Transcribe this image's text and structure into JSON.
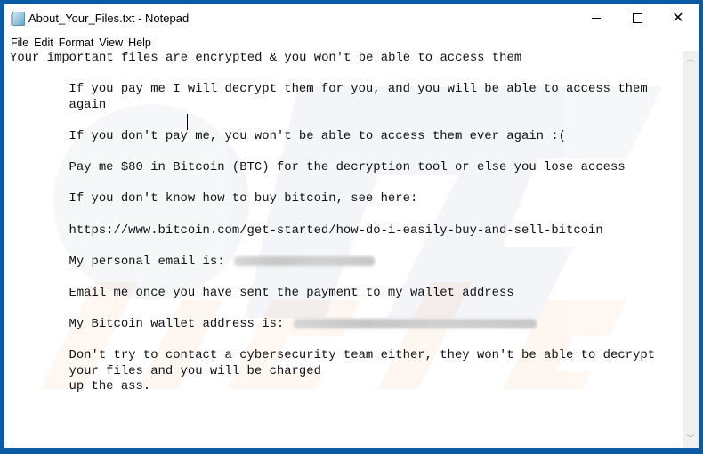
{
  "window": {
    "title": "About_Your_Files.txt - Notepad",
    "icon": "notepad-icon",
    "controls": {
      "minimize": "minimize-icon",
      "maximize": "maximize-icon",
      "close": "close-icon"
    }
  },
  "menu": {
    "items": [
      "File",
      "Edit",
      "Format",
      "View",
      "Help"
    ]
  },
  "document": {
    "lines": [
      {
        "indent": false,
        "text": "Your important files are encrypted & you won't be able to access them"
      },
      {
        "indent": false,
        "text": ""
      },
      {
        "indent": true,
        "text": "If you pay me I will decrypt them for you, and you will be able to access them"
      },
      {
        "indent": true,
        "text": "again"
      },
      {
        "indent": false,
        "text": ""
      },
      {
        "indent": true,
        "text": "If you don't pay me, you won't be able to access them ever again :("
      },
      {
        "indent": false,
        "text": ""
      },
      {
        "indent": true,
        "text": "Pay me $80 in Bitcoin (BTC) for the decryption tool or else you lose access"
      },
      {
        "indent": false,
        "text": ""
      },
      {
        "indent": true,
        "text": "If you don't know how to buy bitcoin, see here:"
      },
      {
        "indent": false,
        "text": ""
      },
      {
        "indent": true,
        "text": "https://www.bitcoin.com/get-started/how-do-i-easily-buy-and-sell-bitcoin"
      },
      {
        "indent": false,
        "text": ""
      },
      {
        "indent": true,
        "text": "My personal email is: ",
        "redacted": "email"
      },
      {
        "indent": false,
        "text": ""
      },
      {
        "indent": true,
        "text": "Email me once you have sent the payment to my wallet address"
      },
      {
        "indent": false,
        "text": ""
      },
      {
        "indent": true,
        "text": "My Bitcoin wallet address is: ",
        "redacted": "wallet"
      },
      {
        "indent": false,
        "text": ""
      },
      {
        "indent": true,
        "text": "Don't try to contact a cybersecurity team either, they won't be able to decrypt"
      },
      {
        "indent": true,
        "text": "your files and you will be charged"
      },
      {
        "indent": true,
        "text": "up the ass."
      }
    ]
  },
  "scrollbar": {
    "up": "chevron-up-icon",
    "down": "chevron-down-icon"
  },
  "colors": {
    "frame": "#0b5aa6",
    "text": "#111111",
    "scrollbar_track": "#f0f0f0"
  }
}
